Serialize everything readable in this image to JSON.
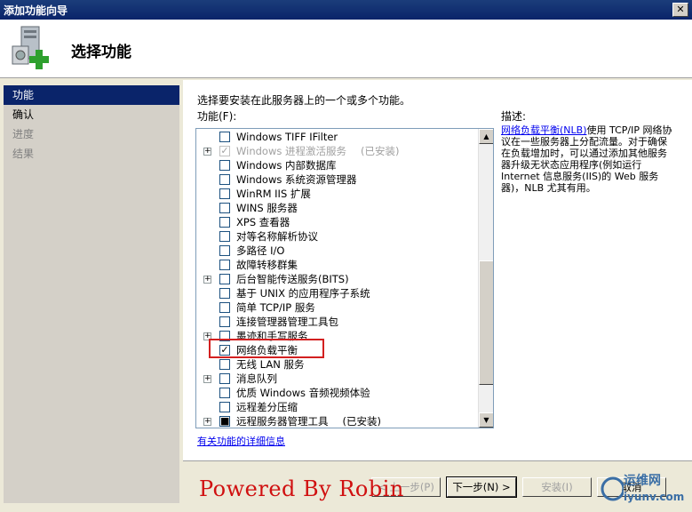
{
  "window": {
    "title": "添加功能向导",
    "close_glyph": "✕"
  },
  "banner": {
    "heading": "选择功能"
  },
  "steps": [
    {
      "label": "功能",
      "state": "active"
    },
    {
      "label": "确认",
      "state": "normal"
    },
    {
      "label": "进度",
      "state": "disabled"
    },
    {
      "label": "结果",
      "state": "disabled"
    }
  ],
  "main": {
    "intro": "选择要安装在此服务器上的一个或多个功能。",
    "list_label": "功能(F):",
    "desc_label": "描述:",
    "description_link": "网络负载平衡(NLB)",
    "description_text": "使用 TCP/IP 网络协议在一些服务器上分配流量。对于确保在负载增加时，可以通过添加其他服务器升级无状态应用程序(例如运行 Internet 信息服务(IIS)的 Web 服务器)，NLB 尤其有用。",
    "more_info": "有关功能的详细信息"
  },
  "features": [
    {
      "expander": "",
      "check": "",
      "label": "Windows TIFF IFilter",
      "note": "",
      "disabled": false
    },
    {
      "expander": "+",
      "check": "✓",
      "label": "Windows 进程激活服务",
      "note": "(已安装)",
      "disabled": true
    },
    {
      "expander": "",
      "check": "",
      "label": "Windows 内部数据库",
      "note": "",
      "disabled": false
    },
    {
      "expander": "",
      "check": "",
      "label": "Windows 系统资源管理器",
      "note": "",
      "disabled": false
    },
    {
      "expander": "",
      "check": "",
      "label": "WinRM IIS 扩展",
      "note": "",
      "disabled": false
    },
    {
      "expander": "",
      "check": "",
      "label": "WINS 服务器",
      "note": "",
      "disabled": false
    },
    {
      "expander": "",
      "check": "",
      "label": "XPS 查看器",
      "note": "",
      "disabled": false
    },
    {
      "expander": "",
      "check": "",
      "label": "对等名称解析协议",
      "note": "",
      "disabled": false
    },
    {
      "expander": "",
      "check": "",
      "label": "多路径 I/O",
      "note": "",
      "disabled": false
    },
    {
      "expander": "",
      "check": "",
      "label": "故障转移群集",
      "note": "",
      "disabled": false
    },
    {
      "expander": "+",
      "check": "",
      "label": "后台智能传送服务(BITS)",
      "note": "",
      "disabled": false
    },
    {
      "expander": "",
      "check": "",
      "label": "基于 UNIX 的应用程序子系统",
      "note": "",
      "disabled": false
    },
    {
      "expander": "",
      "check": "",
      "label": "简单 TCP/IP 服务",
      "note": "",
      "disabled": false
    },
    {
      "expander": "",
      "check": "",
      "label": "连接管理器管理工具包",
      "note": "",
      "disabled": false
    },
    {
      "expander": "+",
      "check": "",
      "label": "墨迹和手写服务",
      "note": "",
      "disabled": false
    },
    {
      "expander": "",
      "check": "✓",
      "label": "网络负载平衡",
      "note": "",
      "disabled": false
    },
    {
      "expander": "",
      "check": "",
      "label": "无线 LAN 服务",
      "note": "",
      "disabled": false
    },
    {
      "expander": "+",
      "check": "",
      "label": "消息队列",
      "note": "",
      "disabled": false
    },
    {
      "expander": "",
      "check": "",
      "label": "优质 Windows 音频视频体验",
      "note": "",
      "disabled": false
    },
    {
      "expander": "",
      "check": "",
      "label": "远程差分压缩",
      "note": "",
      "disabled": false
    },
    {
      "expander": "+",
      "check": "■",
      "label": "远程服务器管理工具",
      "note": "(已安装)",
      "disabled": false
    }
  ],
  "scrollbar": {
    "up_glyph": "▲",
    "down_glyph": "▼"
  },
  "buttons": {
    "previous": "< 上一步(P)",
    "next": "下一步(N) >",
    "install": "安装(I)",
    "cancel": "取消"
  },
  "watermark": {
    "text": "Powered By Robin",
    "site_cn": "运维网",
    "site_en": "iyunv.com"
  }
}
